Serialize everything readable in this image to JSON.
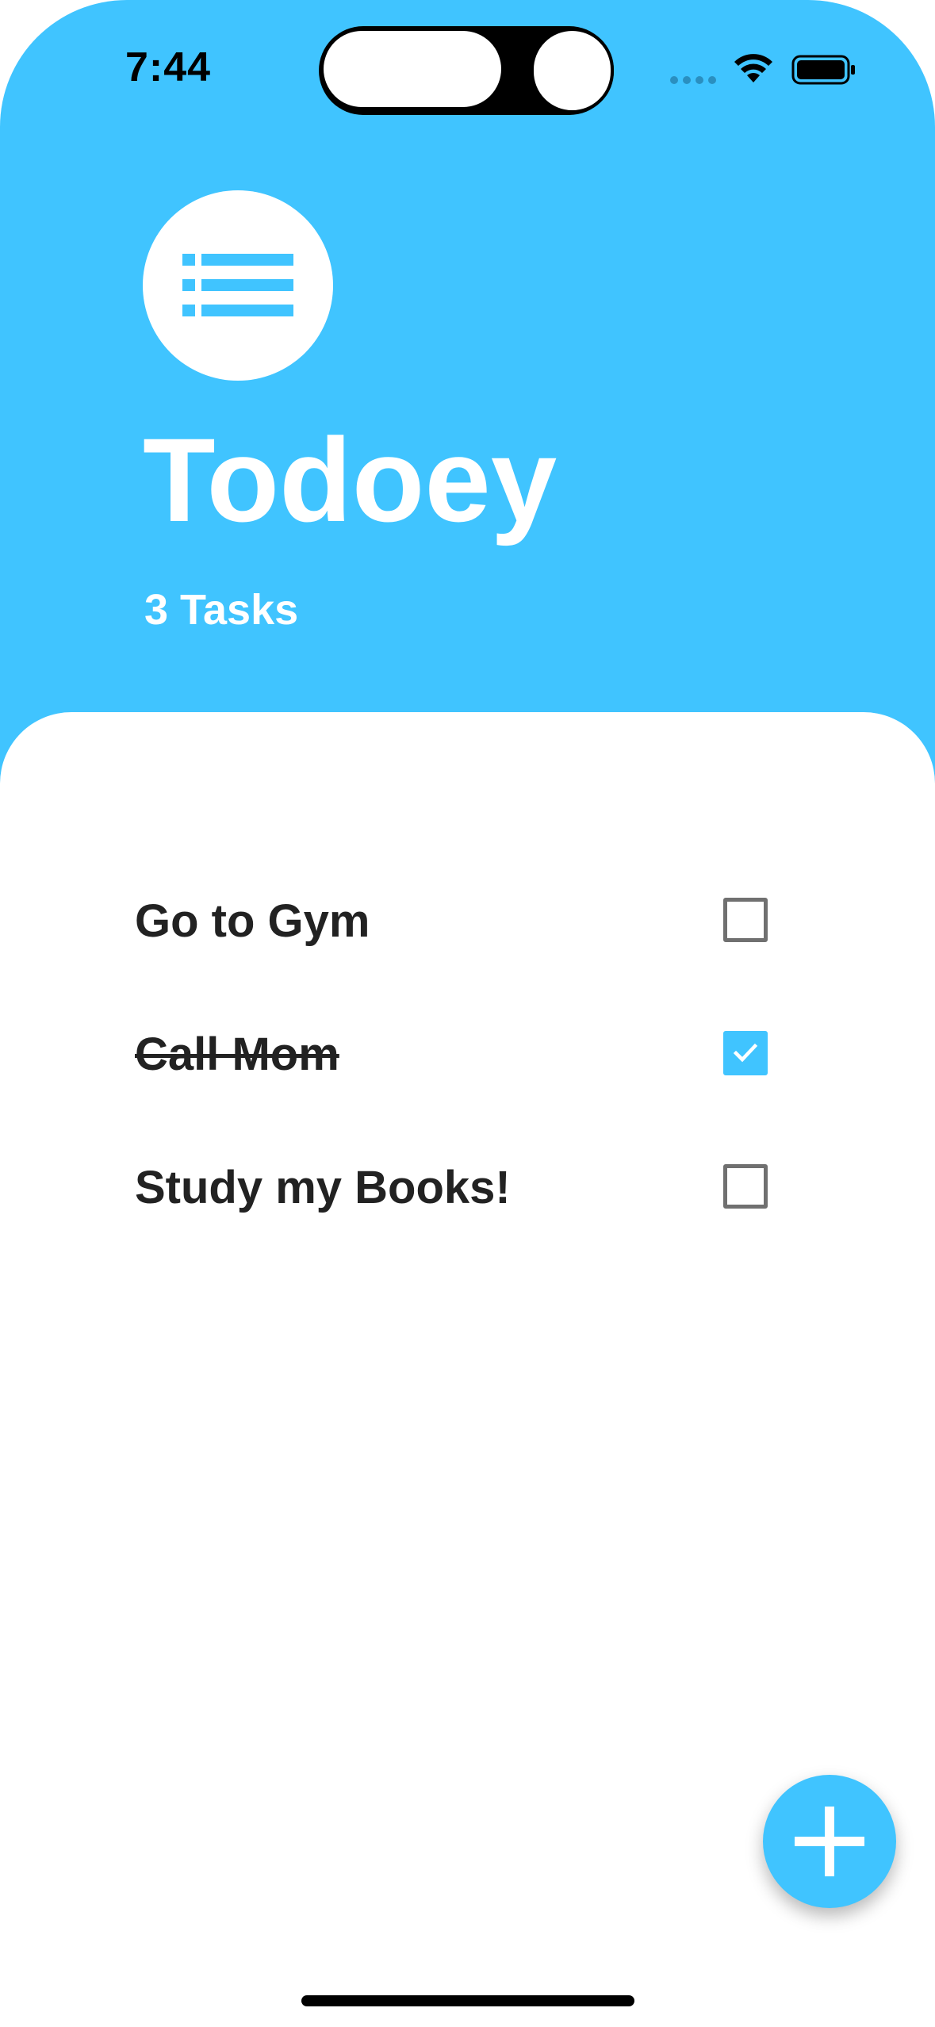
{
  "status_bar": {
    "time": "7:44"
  },
  "header": {
    "logo_icon": "list-icon",
    "title": "Todoey",
    "task_count": "3 Tasks"
  },
  "tasks": [
    {
      "label": "Go to Gym",
      "done": false
    },
    {
      "label": "Call Mom",
      "done": true
    },
    {
      "label": "Study my Books!",
      "done": false
    }
  ],
  "fab": {
    "icon": "plus-icon"
  },
  "colors": {
    "accent": "#40c4ff",
    "text": "#222222",
    "checkbox_border": "#707070"
  }
}
